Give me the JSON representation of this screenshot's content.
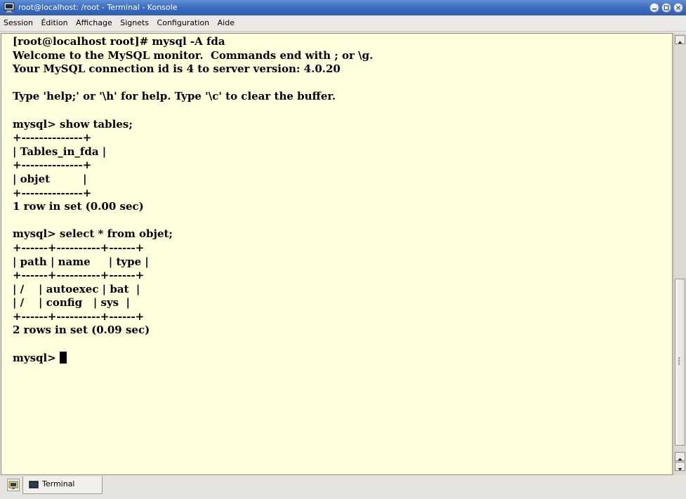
{
  "window": {
    "title": "root@localhost: /root - Terminal - Konsole",
    "app_icon": "konsole-monitor-icon",
    "buttons": [
      "minimize-icon",
      "maximize-icon",
      "close-icon"
    ],
    "title_bar_color": "#3c6cc0"
  },
  "menubar": {
    "items": [
      "Session",
      "Édition",
      "Affichage",
      "Signets",
      "Configuration",
      "Aide"
    ]
  },
  "terminal": {
    "background": "#ffffdd",
    "lines": [
      "[root@localhost root]# mysql -A fda",
      "Welcome to the MySQL monitor.  Commands end with ; or \\g.",
      "Your MySQL connection id is 4 to server version: 4.0.20",
      "",
      "Type 'help;' or '\\h' for help. Type '\\c' to clear the buffer.",
      "",
      "mysql> show tables;",
      "+--------------+",
      "| Tables_in_fda |",
      "+--------------+",
      "| objet         |",
      "+--------------+",
      "1 row in set (0.00 sec)",
      "",
      "mysql> select * from objet;",
      "+------+----------+------+",
      "| path | name     | type |",
      "+------+----------+------+",
      "| /    | autoexec | bat  |",
      "| /    | config   | sys  |",
      "+------+----------+------+",
      "2 rows in set (0.09 sec)",
      ""
    ],
    "prompt": "mysql> "
  },
  "tabs": {
    "new_tab_icon": "new-session-icon",
    "items": [
      {
        "label": "Terminal",
        "icon": "terminal-icon"
      }
    ]
  }
}
